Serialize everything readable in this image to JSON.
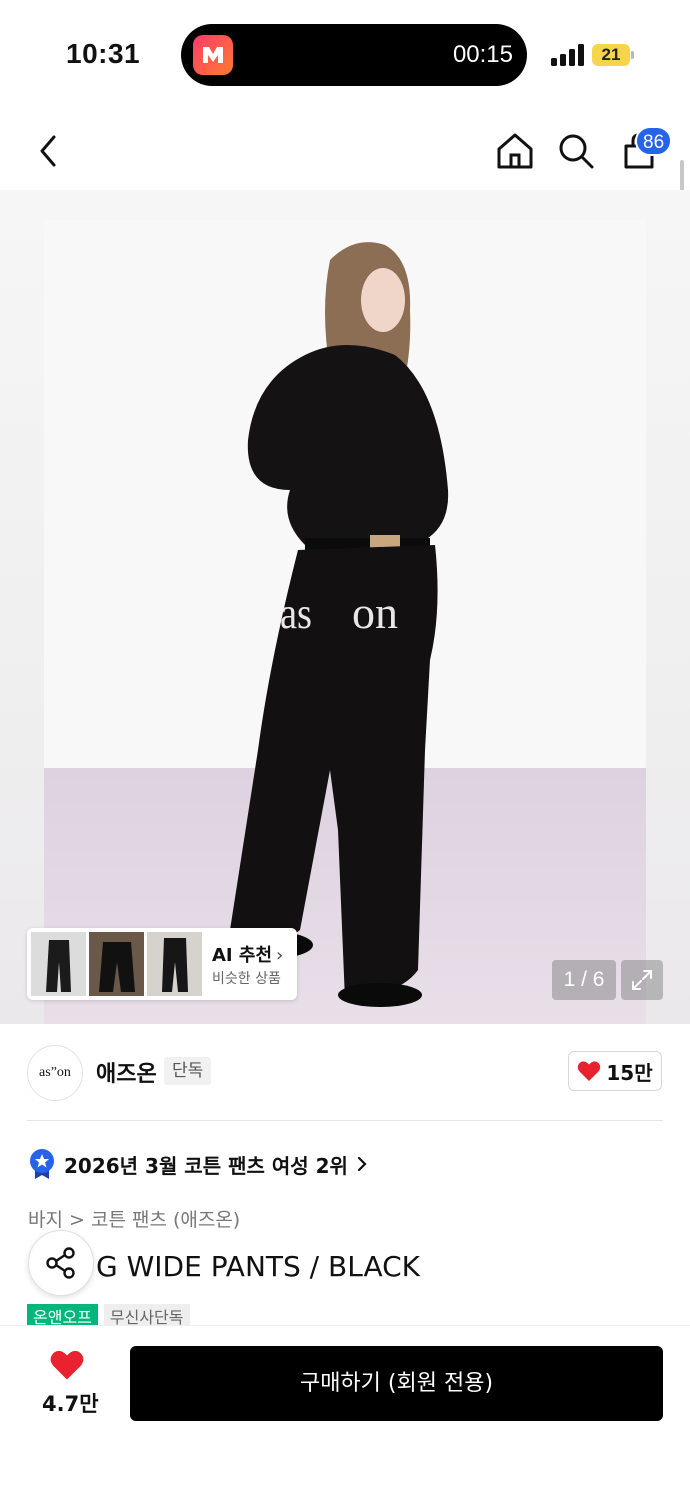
{
  "status_bar": {
    "time": "10:31",
    "timer": "00:15",
    "battery": "21",
    "battery_color": "#f5d54a"
  },
  "nav": {
    "back_icon": "chevron-left-icon",
    "home_icon": "home-icon",
    "search_icon": "search-icon",
    "cart_icon": "shopping-bag-icon",
    "cart_count": "86",
    "badge_color": "#2563eb"
  },
  "gallery": {
    "jeans_print_left": "as",
    "jeans_print_right": "on",
    "ai_recommend": {
      "title": "AI 추천",
      "subtitle": "비슷한 상품"
    },
    "page_counter": "1 / 6"
  },
  "brand": {
    "logo_text": "as”on",
    "name": "애즈온",
    "exclusive_label": "단독",
    "like_count": "15만"
  },
  "ranking": {
    "text": "2026년 3월 코튼 팬츠 여성 2위"
  },
  "breadcrumb": {
    "text": "바지 > 코튼 팬츠 (애즈온)"
  },
  "product": {
    "title": "G WIDE PANTS / BLACK"
  },
  "tags": [
    "온앤오프",
    "무신사단독"
  ],
  "colors": {
    "heart": "#e8232f",
    "tag_green": "#00b67a"
  },
  "bottom_bar": {
    "wish_count": "4.7만",
    "buy_label": "구매하기 (회원 전용)"
  }
}
